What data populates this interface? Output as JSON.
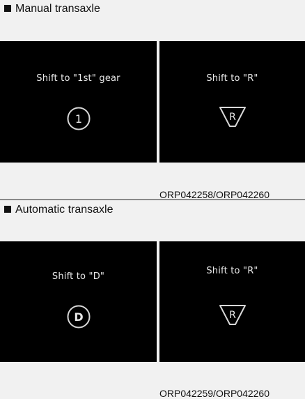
{
  "manual": {
    "heading": "Manual transaxle",
    "panels": [
      {
        "message": "Shift to \"1st\" gear",
        "symbol": "1",
        "symbol_icon": "circle-gear-icon"
      },
      {
        "message": "Shift to \"R\"",
        "symbol": "R",
        "symbol_icon": "reverse-triangle-icon"
      }
    ],
    "code": "ORP042258/ORP042260"
  },
  "automatic": {
    "heading": "Automatic transaxle",
    "panels": [
      {
        "message": "Shift to \"D\"",
        "symbol": "D",
        "symbol_icon": "circle-gear-icon"
      },
      {
        "message": "Shift to \"R\"",
        "symbol": "R",
        "symbol_icon": "reverse-triangle-icon"
      }
    ],
    "code": "ORP042259/ORP042260"
  },
  "colors": {
    "panel_bg": "#000000",
    "panel_text": "#e9e9e9",
    "page_band": "#f1f1f1"
  }
}
